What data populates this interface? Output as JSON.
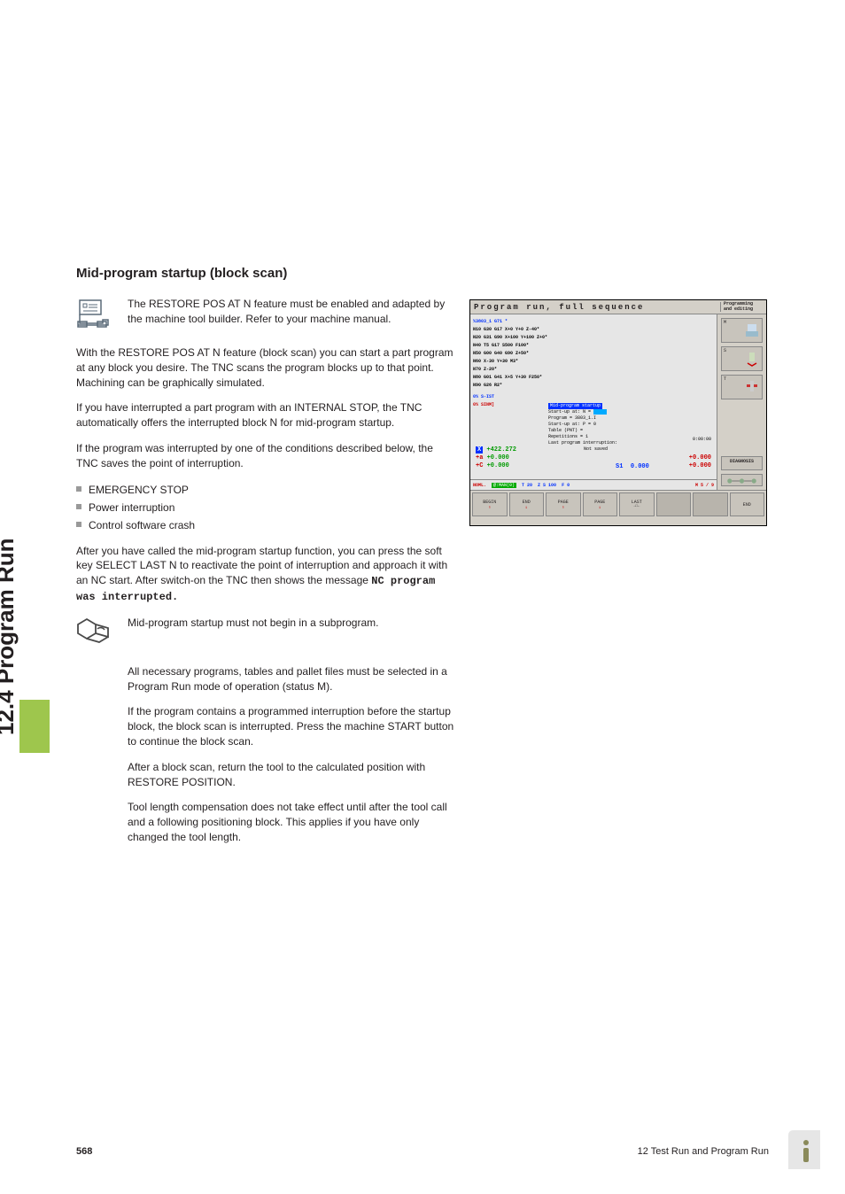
{
  "sidebar": {
    "section": "12.4 Program Run"
  },
  "heading": "Mid-program startup (block scan)",
  "note1": "The RESTORE POS AT N feature must be enabled and adapted by the machine tool builder. Refer to your machine manual.",
  "p1": "With the RESTORE POS AT N feature (block scan) you can start a part program at any block you desire. The TNC scans the program blocks up to that point. Machining can be graphically simulated.",
  "p2": "If you have interrupted a part program with an INTERNAL STOP, the TNC automatically offers the interrupted block N for mid-program startup.",
  "p3": "If the program was interrupted by one of the conditions described below, the TNC saves the point of interruption.",
  "bullets1": [
    "EMERGENCY STOP",
    "Power interruption",
    "Control software crash"
  ],
  "p4a": "After you have called the mid-program startup function, you can press the soft key SELECT LAST N to reactivate the point of interruption and approach it with an NC start. After switch-on the TNC then shows the message ",
  "p4b": "NC program was interrupted.",
  "info": [
    "Mid-program startup must not begin in a subprogram.",
    "All necessary programs, tables and pallet files must be selected in a Program Run mode of operation (status M).",
    "If the program contains a programmed interruption before the startup block, the block scan is interrupted. Press the machine START button to continue the block scan.",
    "After a block scan, return the tool to the calculated position with RESTORE POSITION.",
    "Tool length compensation does not take effect until after the tool call and a following positioning block. This applies if you have only changed the tool length."
  ],
  "screenshot": {
    "title": "Program run, full sequence",
    "mode": "Programming and editing",
    "prog": [
      "%3803_1 G71 *",
      "N10 G30 G17 X+0 Y+0 Z-40*",
      "N20 G31 G90 X+100 Y+100 Z+0*",
      "N40 T5 G17 S500 F100*",
      "N50 G00 G40 G90 Z+50*",
      "N60 X-30 Y+30 M3*",
      "N70 Z-20*",
      "N80 G01 G41 X+5 Y+30 F250*",
      "N90 G26 R2*"
    ],
    "midbox": {
      "header": "Mid-program startup",
      "l1": "Start-up at: N =",
      "l2": "Program       = 3803_1.I",
      "l3": "Start-up at: P = 0",
      "l4": "Table (PNT)   =",
      "l5": "Repetitions   = 1",
      "l6": "Last program interruption:",
      "l7": "Not saved"
    },
    "tables": {
      "a": "0% S-IST",
      "b": "0% SINM]"
    },
    "coords": {
      "x": "X",
      "xv": "+422.272",
      "a": "+a",
      "av": "+0.000",
      "c": "+C",
      "cv": "+0.000"
    },
    "time": "0:00:00",
    "rcoords": {
      "v1": "+0.000",
      "v2": "+0.000"
    },
    "spindle": {
      "l": "S1",
      "v": "0.000"
    },
    "status": {
      "nom": "NOML.",
      "man": "@:MAN(0)",
      "t": "T 20",
      "z": "Z S 100",
      "f": "F 0",
      "m": "M 5 / 9"
    },
    "rbtns": {
      "m": "M",
      "s": "S",
      "t": "T",
      "diag": "DIAGNOSIS"
    },
    "softkeys": [
      "BEGIN",
      "END",
      "PAGE",
      "PAGE",
      "LAST",
      "",
      "",
      "END"
    ]
  },
  "footer": {
    "page": "568",
    "chapter": "12 Test Run and Program Run"
  }
}
